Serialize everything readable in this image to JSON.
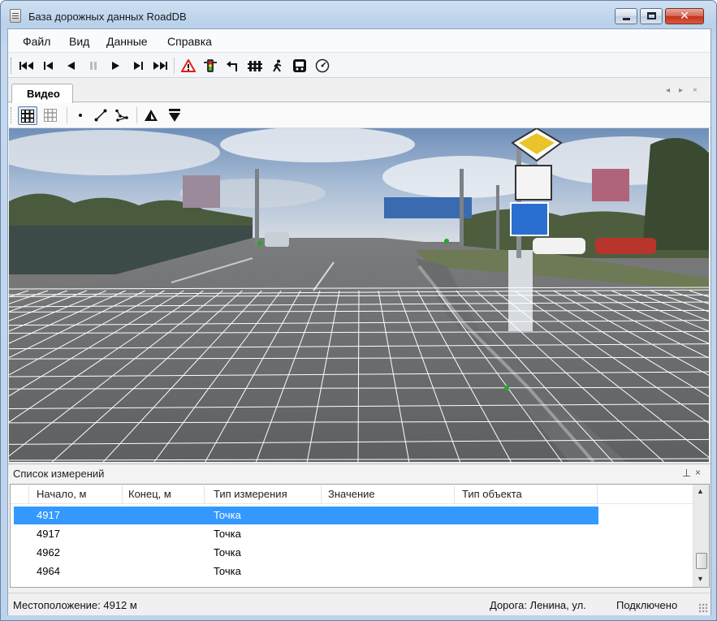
{
  "window": {
    "title": "База дорожных данных RoadDB"
  },
  "menu": [
    "Файл",
    "Вид",
    "Данные",
    "Справка"
  ],
  "toolbar": {
    "icons": [
      "first-icon",
      "prev-segment-icon",
      "play-backward-icon",
      "pause-icon",
      "play-icon",
      "next-segment-icon",
      "last-icon",
      "warning-sign-icon",
      "traffic-light-icon",
      "turn-icon",
      "fence-icon",
      "pedestrian-icon",
      "bus-stop-icon",
      "speedometer-icon"
    ]
  },
  "document_tab": {
    "label": "Видео",
    "controls": [
      "◂",
      "▸",
      "×"
    ]
  },
  "video_toolbar": {
    "icons": [
      "grid-icon",
      "grid-dim-icon",
      "point-icon",
      "line-icon",
      "polyline-icon",
      "fill-icon",
      "marker-down-icon"
    ]
  },
  "measurements_panel": {
    "title": "Список измерений",
    "columns": [
      "Начало, м",
      "Конец, м",
      "Тип измерения",
      "Значение",
      "Тип объекта"
    ],
    "rows": [
      {
        "start": "4917",
        "end": "",
        "type": "Точка",
        "value": "",
        "object": "",
        "selected": true
      },
      {
        "start": "4917",
        "end": "",
        "type": "Точка",
        "value": "",
        "object": "",
        "selected": false
      },
      {
        "start": "4962",
        "end": "",
        "type": "Точка",
        "value": "",
        "object": "",
        "selected": false
      },
      {
        "start": "4964",
        "end": "",
        "type": "Точка",
        "value": "",
        "object": "",
        "selected": false
      }
    ]
  },
  "status": {
    "location": "Местоположение: 4912 м",
    "road": "Дорога: Ленина, ул.",
    "connection": "Подключено"
  },
  "colors": {
    "selection": "#3399ff",
    "grid_overlay": "#ffffff",
    "marker": "#22aa22"
  }
}
